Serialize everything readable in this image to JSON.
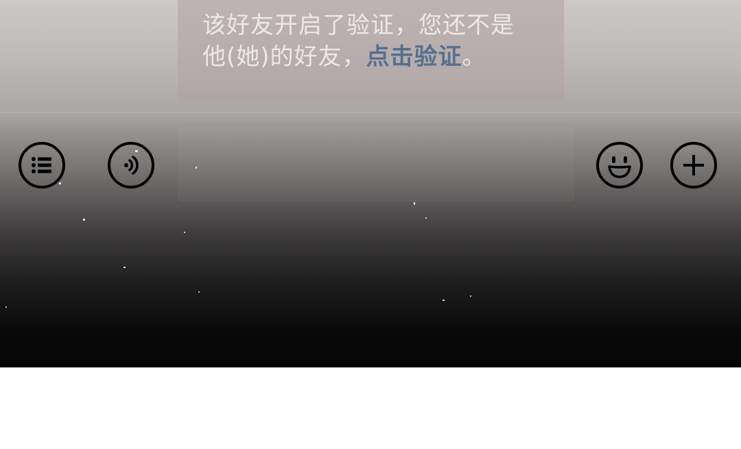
{
  "notice": {
    "line1": "该好友开启了验证，您还不是",
    "line2_prefix": "他(她)的好友，",
    "verify_link": "点击验证",
    "line2_suffix": "。"
  },
  "toolbar": {
    "left": [
      "menu-list-icon",
      "voice-wave-icon"
    ],
    "right": [
      "emoji-smile-icon",
      "plus-icon"
    ]
  },
  "colors": {
    "notice_text": "#ece8e8",
    "link": "#55708f",
    "icon_stroke": "#000000"
  }
}
